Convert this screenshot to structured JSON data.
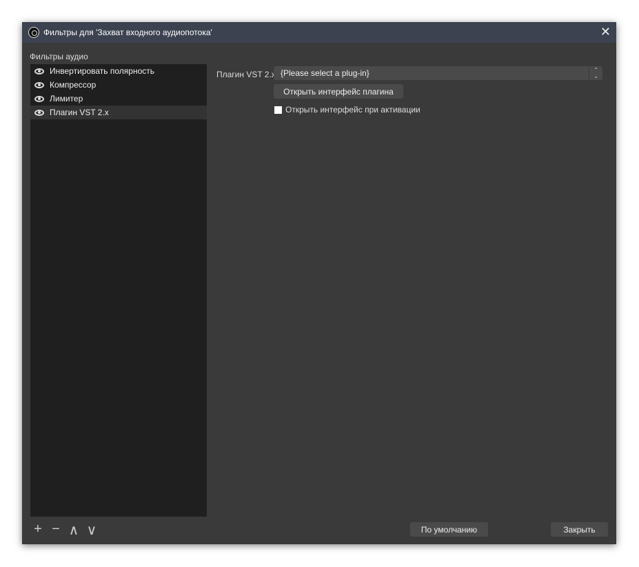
{
  "window": {
    "title": "Фильтры для 'Захват входного аудиопотока'",
    "close": "✕"
  },
  "filters": {
    "label": "Фильтры аудио",
    "items": [
      {
        "label": "Инвертировать полярность"
      },
      {
        "label": "Компрессор"
      },
      {
        "label": "Лимитер"
      },
      {
        "label": "Плагин VST 2.x",
        "selected": true
      }
    ],
    "tools": {
      "add": "+",
      "remove": "−",
      "up": "∧",
      "down": "∨"
    }
  },
  "settings": {
    "plugin_label": "Плагин VST 2.x",
    "plugin_value": "{Please select a plug-in}",
    "open_button": "Открыть интерфейс плагина",
    "open_on_activate": "Открыть интерфейс при активации",
    "open_on_activate_checked": false
  },
  "footer": {
    "defaults": "По умолчанию",
    "close": "Закрыть"
  }
}
